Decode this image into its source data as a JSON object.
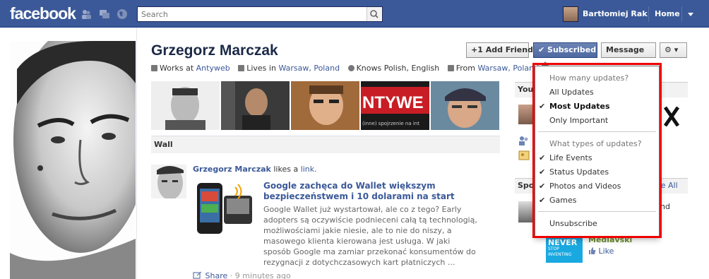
{
  "header": {
    "logo": "facebook",
    "search_placeholder": "Search",
    "user_name": "Bartłomiej Rak",
    "home_label": "Home"
  },
  "profile": {
    "name": "Grzegorz Marczak",
    "info": {
      "works_prefix": "Works at",
      "works_at": "Antyweb",
      "lives_prefix": "Lives in",
      "lives_in": "Warsaw, Poland",
      "knows": "Knows Polish, English",
      "from_prefix": "From",
      "from": "Warsaw, Poland"
    },
    "buttons": {
      "add_friend": "+1 Add Friend",
      "subscribed": "✔ Subscribed",
      "message": "Message",
      "gear": "⚙ ▾"
    },
    "photo_text": "NTYWE",
    "photo_subtext": "(inne) spojrzenie na int"
  },
  "wall": {
    "label": "Wall",
    "story": {
      "actor": "Grzegorz Marczak",
      "action": "likes a",
      "object": "link.",
      "link_title": "Google zachęca do Wallet większym bezpieczeństwem i 10 dolarami na start",
      "link_desc": "Google Wallet już wystartował, ale co z tego? Early adopters są oczywiście podnieceni całą tą technologią, możliwościami jakie niesie, ale to nie do niszy, a masowego klienta kierowana jest usługa. W jaki sposób Google ma zamiar przekonać konsumentów do rezygnacji z dotychczasowych kart płatniczych ...",
      "share_label": "Share",
      "time": "· 9 minutes ago"
    }
  },
  "right_col": {
    "head1": "You",
    "head2": "Spo",
    "see_all": "ee All",
    "nd": "nd",
    "fan_name": "Mediavski",
    "like_label": "Like",
    "never_title": "NEVER",
    "never_sub": "STOP INVENTING"
  },
  "menu": {
    "header_updates": "How many updates?",
    "all_updates": "All Updates",
    "most_updates": "Most Updates",
    "only_important": "Only Important",
    "header_types": "What types of updates?",
    "life_events": "Life Events",
    "status_updates": "Status Updates",
    "photos_videos": "Photos and Videos",
    "games": "Games",
    "unsubscribe": "Unsubscribe",
    "check": "✔"
  },
  "colors": {
    "brand": "#3b5998",
    "highlight": "#ee0000"
  }
}
